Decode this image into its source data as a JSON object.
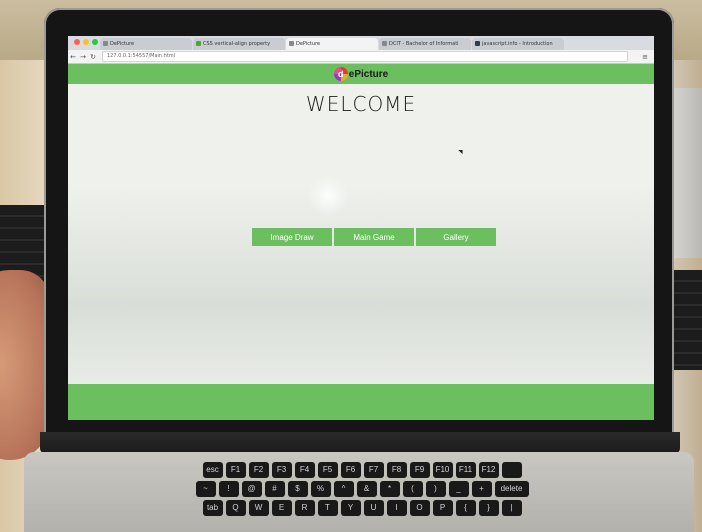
{
  "browser": {
    "tabs": [
      {
        "label": "DePicture",
        "active": false
      },
      {
        "label": "CSS vertical-align property",
        "active": false
      },
      {
        "label": "DePicture",
        "active": true
      },
      {
        "label": "DCIT - Bachelor of Informati",
        "active": false
      },
      {
        "label": "javascript.info - Introduction",
        "active": false
      }
    ],
    "url": "127.0.0.1:54557/Main.html"
  },
  "page": {
    "logo_mark": "d",
    "logo_text": "ePicture",
    "title": "WELCOME",
    "nav": [
      "Image Draw",
      "Main Game",
      "Gallery"
    ]
  },
  "colors": {
    "brand_green": "#6cbf5e",
    "page_bg": "#eef1ec"
  },
  "keyboard": {
    "rows": [
      [
        "esc",
        "F1",
        "F2",
        "F3",
        "F4",
        "F5",
        "F6",
        "F7",
        "F8",
        "F9",
        "F10",
        "F11",
        "F12",
        ""
      ],
      [
        "~",
        "!",
        "@",
        "#",
        "$",
        "%",
        "^",
        "&",
        "*",
        "(",
        ")",
        "_",
        "+",
        "delete"
      ],
      [
        "tab",
        "Q",
        "W",
        "E",
        "R",
        "T",
        "Y",
        "U",
        "I",
        "O",
        "P",
        "{",
        "}",
        "|"
      ]
    ]
  }
}
